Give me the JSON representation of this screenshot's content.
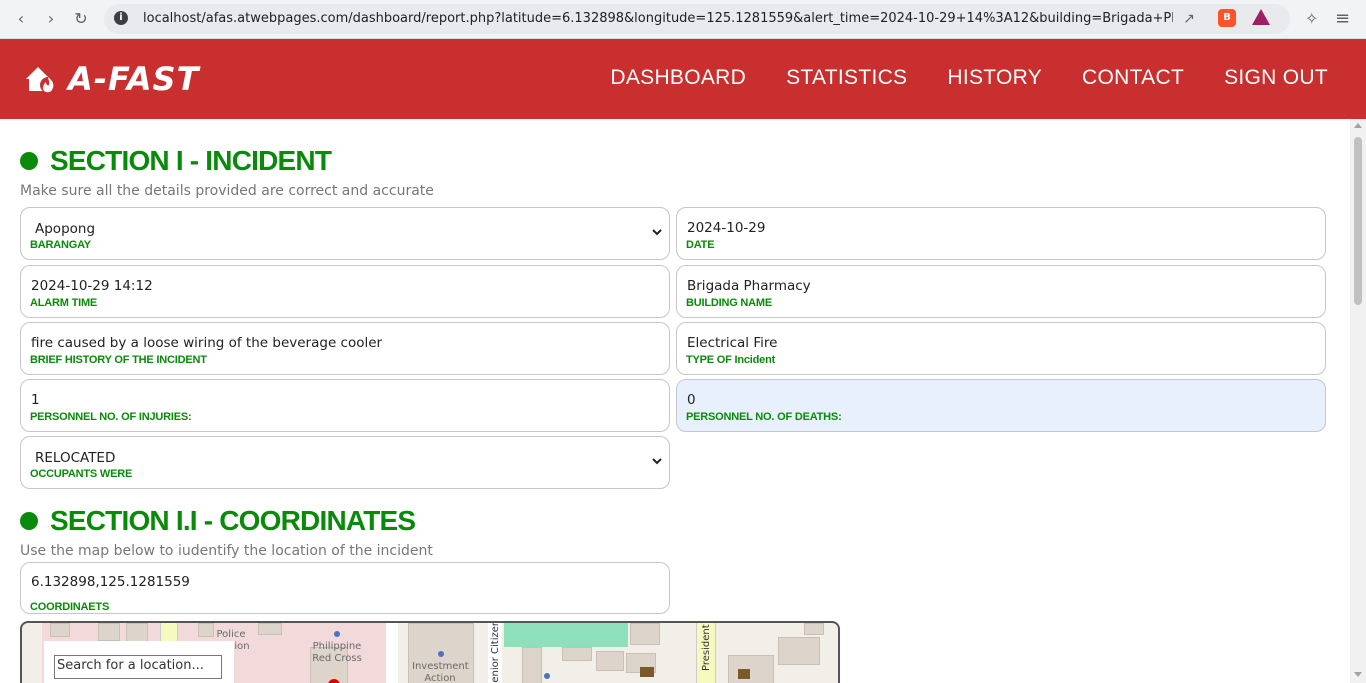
{
  "browser": {
    "url": "localhost/afas.atwebpages.com/dashboard/report.php?latitude=6.132898&longitude=125.1281559&alert_time=2024-10-29+14%3A12&building=Brigada+Pharmacy"
  },
  "header": {
    "logo_text": "A-FAST",
    "nav": [
      "DASHBOARD",
      "STATISTICS",
      "HISTORY",
      "CONTACT",
      "SIGN OUT"
    ],
    "bg_color": "#c92f2f"
  },
  "section1": {
    "title": "SECTION I - INCIDENT",
    "subtitle": "Make sure all the details provided are correct and accurate",
    "fields": {
      "barangay": {
        "value": "Apopong",
        "label": "BARANGAY"
      },
      "date": {
        "value": "2024-10-29",
        "label": "DATE"
      },
      "alarm_time": {
        "value": "2024-10-29 14:12",
        "label": "ALARM TIME"
      },
      "building_name": {
        "value": "Brigada Pharmacy",
        "label": "BUILDING NAME"
      },
      "brief_history": {
        "value": "fire caused by a loose wiring of the beverage cooler",
        "label": "BRIEF HISTORY OF THE INCIDENT"
      },
      "incident_type": {
        "value": "Electrical Fire",
        "label": "TYPE OF Incident"
      },
      "injuries": {
        "value": "1",
        "label": "PERSONNEL NO. OF INJURIES:"
      },
      "deaths": {
        "value": "0",
        "label": "PERSONNEL NO. OF DEATHS:"
      },
      "occupants": {
        "value": "RELOCATED",
        "label": "OCCUPANTS WERE"
      }
    }
  },
  "section11": {
    "title": "SECTION I.I - COORDINATES",
    "subtitle": "Use the map below to iudentify the location of the incident",
    "coordinates": {
      "value": "6.132898,125.1281559",
      "label": "COORDINAETS"
    }
  },
  "map": {
    "search_placeholder": "Search for a location...",
    "labels": {
      "police": "Police\nStation",
      "red_cross": "Philippine\nRed Cross",
      "investment": "Investment\nAction",
      "senior": "Senior Citizens S",
      "president": "President"
    }
  },
  "accent_color": "#0a8a0a"
}
